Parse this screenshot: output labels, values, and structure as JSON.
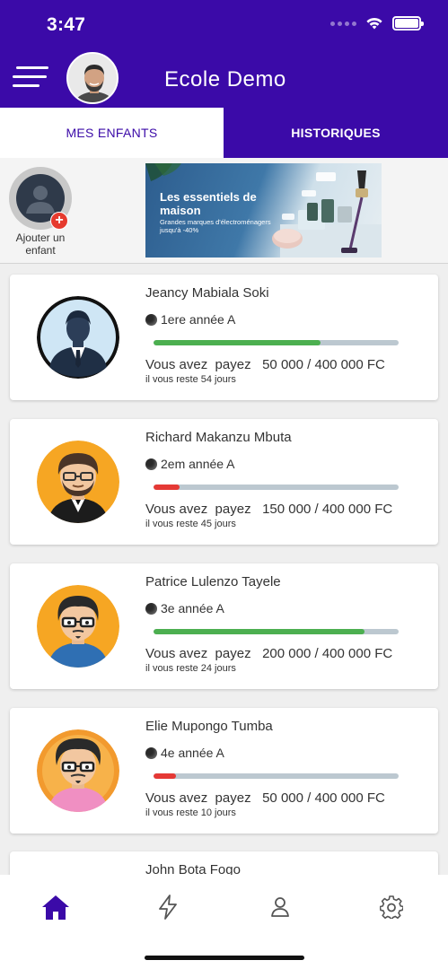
{
  "status_bar": {
    "time": "3:47"
  },
  "header": {
    "title": "Ecole Demo"
  },
  "tabs": [
    {
      "label": "MES ENFANTS",
      "active": true
    },
    {
      "label": "HISTORIQUES",
      "active": false
    }
  ],
  "add_child": {
    "label": "Ajouter un enfant",
    "icon": "plus-icon"
  },
  "banner": {
    "title": "Les essentiels de maison",
    "subtitle": "Grandes marques d'électroménagers jusqu'à -40%"
  },
  "children": [
    {
      "name": "Jeancy Mabiala Soki",
      "class": "1ere année A",
      "pay_label": "Vous avez  payez",
      "paid": "50 000 / 400 000 FC",
      "progress": 0.68,
      "bar_color": "#4caf50",
      "remaining": "il vous reste 54 jours"
    },
    {
      "name": "Richard Makanzu Mbuta",
      "class": "2em année A",
      "pay_label": "Vous avez  payez",
      "paid": "150 000 / 400 000 FC",
      "progress": 0.105,
      "bar_color": "#e53935",
      "remaining": "il vous reste 45 jours"
    },
    {
      "name": "Patrice Lulenzo Tayele",
      "class": "3e année A",
      "pay_label": "Vous avez  payez",
      "paid": "200 000 / 400 000 FC",
      "progress": 0.86,
      "bar_color": "#4caf50",
      "remaining": "il vous reste 24 jours"
    },
    {
      "name": "Elie Mupongo Tumba",
      "class": "4e année A",
      "pay_label": "Vous avez  payez",
      "paid": "50 000 / 400 000 FC",
      "progress": 0.09,
      "bar_color": "#e53935",
      "remaining": "il vous reste 10 jours"
    }
  ],
  "partial_child": {
    "name": "John Bota Fogo"
  },
  "bottom_nav": [
    {
      "icon": "home-icon",
      "active": true
    },
    {
      "icon": "lightning-icon",
      "active": false
    },
    {
      "icon": "user-icon",
      "active": false
    },
    {
      "icon": "gear-icon",
      "active": false
    }
  ],
  "colors": {
    "primary": "#3b0aa8",
    "success": "#4caf50",
    "danger": "#e53935",
    "track": "#bcc8d0"
  }
}
